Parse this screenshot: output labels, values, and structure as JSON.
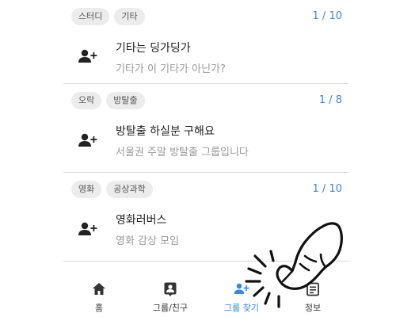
{
  "groups": [
    {
      "tags": [
        "스터디",
        "기타"
      ],
      "count": "1 / 10",
      "title": "기타는 딩가딩가",
      "description": "기타가 이 기타가 아닌가?"
    },
    {
      "tags": [
        "오락",
        "방탈출"
      ],
      "count": "1 / 8",
      "title": "방탈출 하실분 구해요",
      "description": "서울권 주말 방탈출 그룹입니다"
    },
    {
      "tags": [
        "영화",
        "공상과학"
      ],
      "count": "1 / 10",
      "title": "영화러버스",
      "description": "영화 감상 모임"
    }
  ],
  "nav": {
    "items": [
      {
        "label": "홈",
        "icon": "home-icon"
      },
      {
        "label": "그룹/친구",
        "icon": "contact-icon"
      },
      {
        "label": "그룹 찾기",
        "icon": "group-add-icon"
      },
      {
        "label": "정보",
        "icon": "info-icon"
      }
    ],
    "active_index": 2
  },
  "colors": {
    "accent": "#3b86e0",
    "tag_bg": "#ececec",
    "divider": "#d9d9d9",
    "muted_text": "#999999"
  }
}
